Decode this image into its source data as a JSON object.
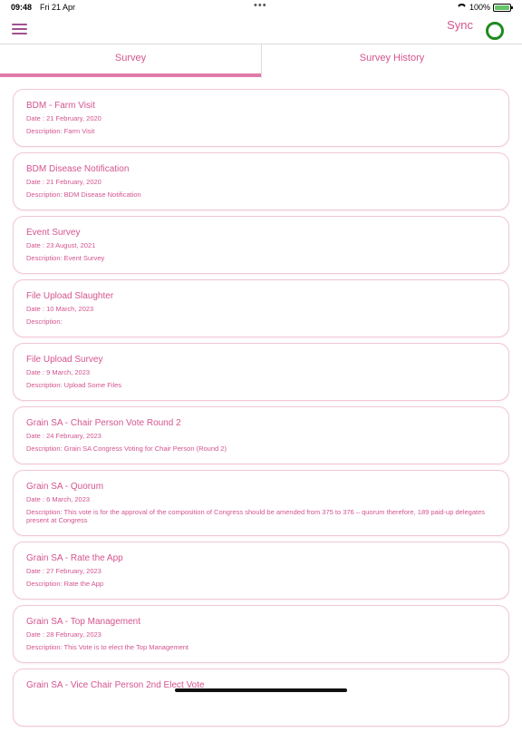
{
  "status_bar": {
    "time": "09:48",
    "date": "Fri 21 Apr",
    "battery": "100%",
    "battery_level": 1.0
  },
  "header": {
    "sync_label": "Sync"
  },
  "tabs": [
    {
      "label": "Survey",
      "active": true
    },
    {
      "label": "Survey History",
      "active": false
    }
  ],
  "surveys": [
    {
      "title": "BDM - Farm Visit",
      "date": "Date : 21 February, 2020",
      "description": "Description: Farm Visit"
    },
    {
      "title": "BDM Disease Notification",
      "date": "Date : 21 February, 2020",
      "description": "Description: BDM Disease Notification"
    },
    {
      "title": "Event Survey",
      "date": "Date : 23 August, 2021",
      "description": "Description: Event Survey"
    },
    {
      "title": "File Upload Slaughter",
      "date": "Date : 10 March, 2023",
      "description": "Description:"
    },
    {
      "title": "File Upload Survey",
      "date": "Date : 9 March, 2023",
      "description": "Description: Upload Some Files"
    },
    {
      "title": "Grain SA - Chair Person Vote Round 2",
      "date": "Date : 24 February, 2023",
      "description": "Description: Grain SA Congress Voting for Chair Person (Round 2)"
    },
    {
      "title": "Grain SA - Quorum",
      "date": "Date : 6 March, 2023",
      "description": "Description: This vote is for the approval of the composition of Congress should be amended from 375 to 376 – quorum therefore, 189 paid-up delegates present at Congress"
    },
    {
      "title": "Grain SA - Rate the App",
      "date": "Date : 27 February, 2023",
      "description": "Description: Rate the App"
    },
    {
      "title": "Grain SA - Top Management",
      "date": "Date : 28 February, 2023",
      "description": "Description: This Vote is to elect the Top Management"
    },
    {
      "title": "Grain SA - Vice Chair Person 2nd Elect Vote",
      "date": "",
      "description": ""
    }
  ],
  "colors": {
    "accent": "#d4548f",
    "tab_indicator": "#e07aa8",
    "card_border": "#f0c6d8",
    "sync_ring": "#1f8a1f",
    "menu_icon": "#a05090"
  }
}
